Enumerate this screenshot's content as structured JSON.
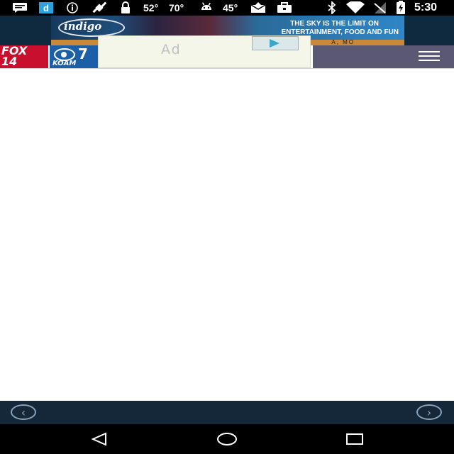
{
  "status_bar": {
    "temp1": "52°",
    "temp2": "70°",
    "temp3": "45°",
    "time": "5:30",
    "icons": [
      "message-icon",
      "d-app-icon",
      "info-icon",
      "satellite-icon",
      "lock-icon",
      "android-icon",
      "mail-upload-icon",
      "briefcase-icon",
      "bluetooth-icon",
      "wifi-icon",
      "signal-icon",
      "battery-charging-icon"
    ],
    "colors": {
      "bar": "#000000",
      "text": "#ffffff",
      "d_app": "#29a3e0"
    }
  },
  "top_banner": {
    "logo": "indigo",
    "tagline_line1": "THE SKY IS THE LIMIT ON",
    "tagline_line2": "ENTERTAINMENT, FOOD AND FUN",
    "location": "A, MO"
  },
  "site_header": {
    "brand_fox": "FOX\n14",
    "brand_cbs_num": "7",
    "brand_koam": "KOAM",
    "menu_icon": "hamburger-menu-icon",
    "colors": {
      "fox": "#c8102e",
      "cbs": "#1a5fa8",
      "menu_bg": "#5a5872"
    }
  },
  "ad": {
    "label": "Ad",
    "button_icon": "play-icon"
  },
  "bottom_nav": {
    "back_icon": "chevron-left-icon",
    "forward_icon": "chevron-right-icon",
    "back_glyph": "‹",
    "forward_glyph": "›",
    "color_bg": "#14283a"
  },
  "system_nav": {
    "back_icon": "nav-back-icon",
    "home_icon": "nav-home-icon",
    "recents_icon": "nav-recents-icon"
  }
}
